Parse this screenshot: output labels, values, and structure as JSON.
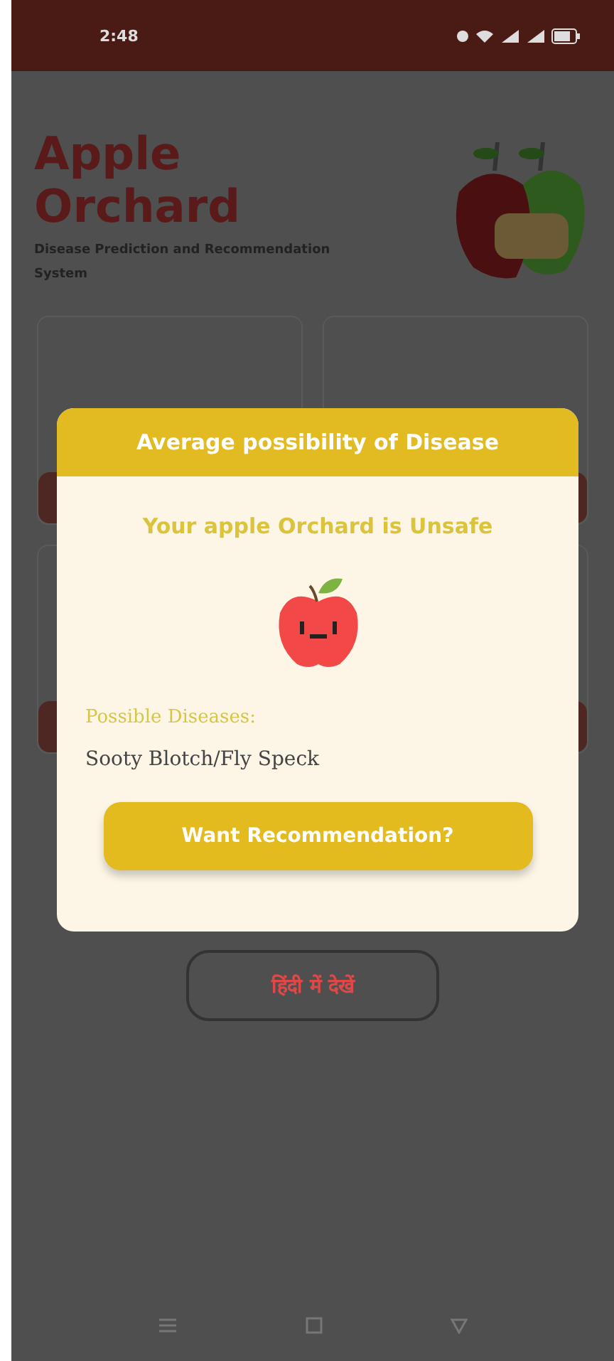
{
  "status_bar": {
    "time": "2:48"
  },
  "header": {
    "title": "Apple Orchard",
    "subtitle": "Disease Prediction and Recommendation System"
  },
  "language_button": {
    "label": "हिंदी में देखें"
  },
  "dialog": {
    "title": "Average possibility of Disease",
    "verdict": "Your apple Orchard is Unsafe",
    "diseases_label": "Possible Diseases:",
    "diseases": "Sooty Blotch/Fly Speck",
    "button": "Want Recommendation?"
  }
}
